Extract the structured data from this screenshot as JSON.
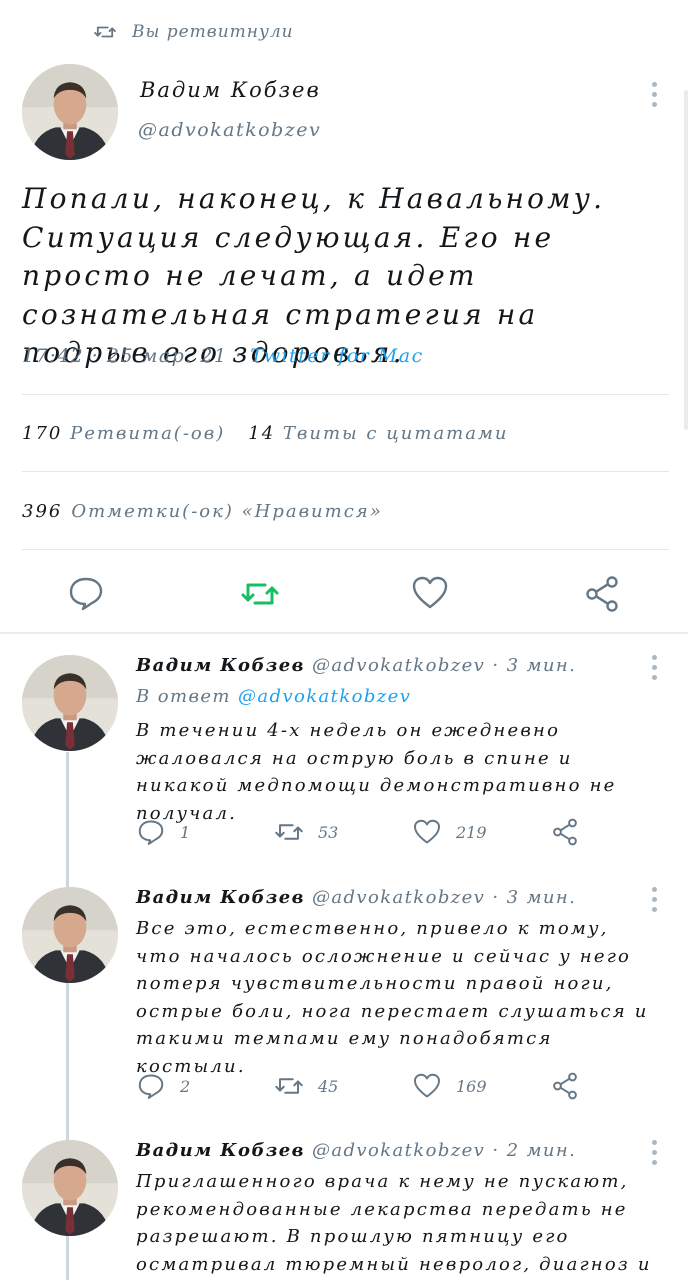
{
  "retweet_header": {
    "label": "Вы ретвитнули"
  },
  "main_tweet": {
    "author_name": "Вадим Кобзев",
    "author_handle": "@advokatkobzev",
    "text": "Попали, наконец, к Навальному. Ситуация следующая. Его не просто не лечат, а идет сознательная стратегия на подрыв его здоровья.",
    "timestamp": "17:42 · 25 мар. 21 · ",
    "source": "Twitter for Mac",
    "retweets_count": "170",
    "retweets_label": "Ретвита(-ов)",
    "quotes_count": "14",
    "quotes_label": "Твиты с цитатами",
    "likes_count": "396",
    "likes_label": "Отметки(-ок) «Нравится»"
  },
  "replies": [
    {
      "author_name": "Вадим Кобзев",
      "author_handle": "@advokatkobzev",
      "time": "· 3 мин.",
      "reply_to_prefix": "В ответ ",
      "reply_to_handle": "@advokatkobzev",
      "text": "В течении 4-х недель он ежедневно жаловался на острую боль в спине и никакой медпомощи демонстративно не получал.",
      "reply_count": "1",
      "retweet_count": "53",
      "like_count": "219"
    },
    {
      "author_name": "Вадим Кобзев",
      "author_handle": "@advokatkobzev",
      "time": "· 3 мин.",
      "text": "Все это, естественно, привело к тому, что началось осложнение и сейчас у него потеря чувствительности правой ноги, острые боли, нога перестает слушаться и такими темпами ему понадобятся костыли.",
      "reply_count": "2",
      "retweet_count": "45",
      "like_count": "169"
    },
    {
      "author_name": "Вадим Кобзев",
      "author_handle": "@advokatkobzev",
      "time": "· 2 мин.",
      "text": "Приглашенного врача к нему не пускают, рекомендованные лекарства передать не разрешают. В прошлую пятницу его осматривал тюремный невролог, диагноз и результаты"
    }
  ],
  "icons": {
    "retweet_header": "retweet-icon",
    "reply": "reply-icon",
    "retweet": "retweet-icon",
    "like": "heart-icon",
    "share": "share-icon",
    "menu": "more-vertical-icon"
  },
  "colors": {
    "text": "#14171a",
    "secondary": "#657786",
    "accent": "#1da1f2",
    "retweet_active": "#17bf63",
    "divider": "#e1e8ed"
  }
}
